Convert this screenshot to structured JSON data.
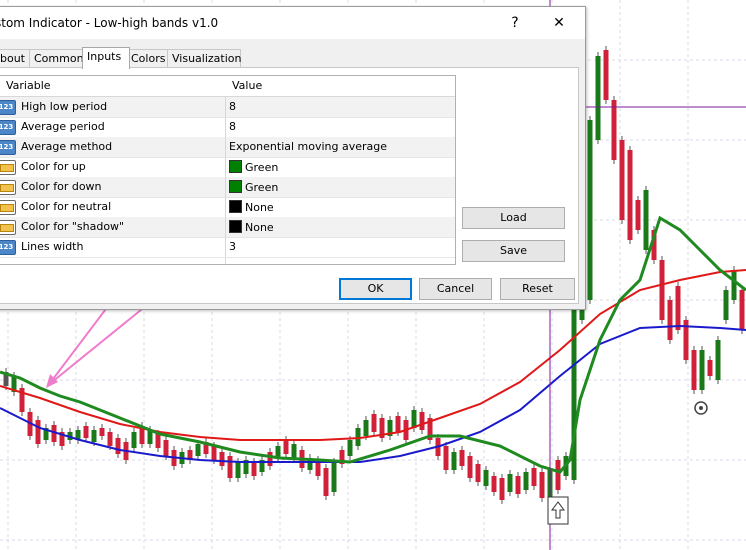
{
  "dialog": {
    "title": "stom Indicator - Low-high bands v1.0",
    "help_label": "?",
    "close_label": "✕"
  },
  "tabs": [
    {
      "label": "bout"
    },
    {
      "label": "Common"
    },
    {
      "label": "Inputs"
    },
    {
      "label": "Colors"
    },
    {
      "label": "Visualization"
    }
  ],
  "grid": {
    "col_variable": "Variable",
    "col_value": "Value",
    "rows": [
      {
        "icon": "123",
        "variable": "High low period",
        "value": "8"
      },
      {
        "icon": "123",
        "variable": "Average period",
        "value": "8"
      },
      {
        "icon": "123",
        "variable": "Average method",
        "value": "Exponential moving average"
      },
      {
        "icon": "color",
        "variable": "Color for up",
        "value": "Green",
        "swatch": "#008000"
      },
      {
        "icon": "color",
        "variable": "Color for down",
        "value": "Green",
        "swatch": "#008000"
      },
      {
        "icon": "color",
        "variable": "Color for neutral",
        "value": "None",
        "swatch": "#000000"
      },
      {
        "icon": "color",
        "variable": "Color for \"shadow\"",
        "value": "None",
        "swatch": "#000000"
      },
      {
        "icon": "123",
        "variable": "Lines width",
        "value": "3"
      }
    ]
  },
  "side_buttons": {
    "load": "Load",
    "save": "Save"
  },
  "footer_buttons": {
    "ok": "OK",
    "cancel": "Cancel",
    "reset": "Reset"
  },
  "colors": {
    "bull_candle": "#1a7a1a",
    "bear_candle": "#d0203a",
    "green_band": "#1f8a1f",
    "red_band": "#e01818",
    "blue_ma": "#1a1acc",
    "crosshair": "#7a1a9a",
    "annotation_arrow": "#f07ccc"
  }
}
